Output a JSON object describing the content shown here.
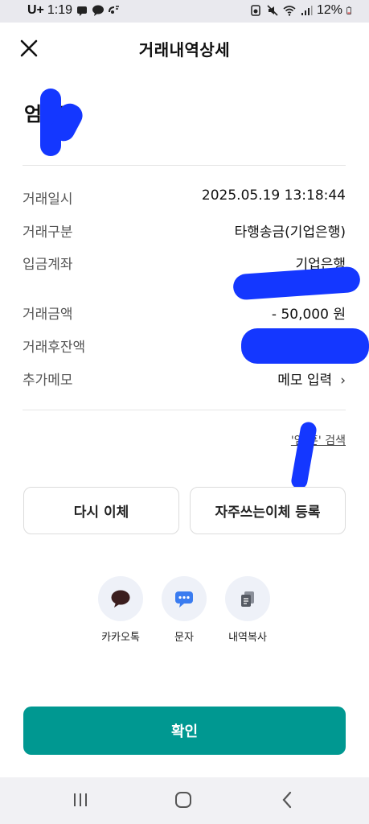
{
  "status_bar": {
    "carrier": "U+",
    "time": "1:19",
    "battery": "12%",
    "icons": [
      "message-icon",
      "chat-icon",
      "voicemail-icon",
      "alarm-icon",
      "mute-icon",
      "wifi-icon",
      "signal-icon",
      "battery-icon"
    ]
  },
  "header": {
    "title": "거래내역상세",
    "close_icon": "close-icon"
  },
  "recipient": {
    "name": "엄 훈"
  },
  "details": [
    {
      "label": "거래일시",
      "value": "2025.05.19 13:18:44"
    },
    {
      "label": "거래구분",
      "value": "타행송금(기업은행)"
    },
    {
      "label": "입금계좌",
      "value": "기업은행"
    },
    {
      "label": "거래금액",
      "value": "- 50,000 원"
    },
    {
      "label": "거래후잔액",
      "value": ""
    },
    {
      "label": "추가메모",
      "value": "메모 입력"
    }
  ],
  "search_link": "'엄 훈' 검색",
  "buttons": {
    "retransfer": "다시 이체",
    "register_frequent": "자주쓰는이체 등록",
    "confirm": "확인"
  },
  "share": [
    {
      "label": "카카오톡",
      "icon": "kakaotalk-icon"
    },
    {
      "label": "문자",
      "icon": "sms-icon"
    },
    {
      "label": "내역복사",
      "icon": "copy-icon"
    }
  ],
  "colors": {
    "accent": "#009891",
    "redaction": "#1437ff",
    "share_bg": "#eef1f8"
  }
}
